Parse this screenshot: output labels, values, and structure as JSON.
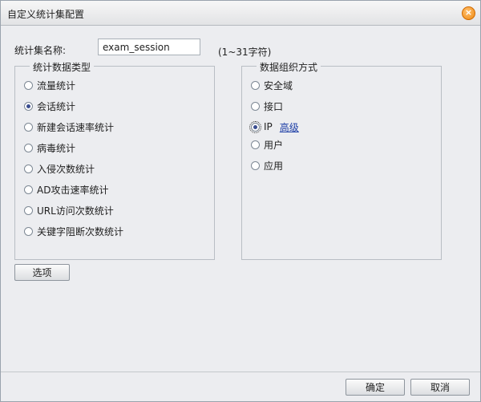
{
  "dialog": {
    "title": "自定义统计集配置",
    "close_icon": "close-icon"
  },
  "name_field": {
    "label": "统计集名称:",
    "value": "exam_session",
    "hint": "(1~31字符)"
  },
  "stats_type": {
    "legend": "统计数据类型",
    "options": [
      {
        "label": "流量统计",
        "checked": false
      },
      {
        "label": "会话统计",
        "checked": true
      },
      {
        "label": "新建会话速率统计",
        "checked": false
      },
      {
        "label": "病毒统计",
        "checked": false
      },
      {
        "label": "入侵次数统计",
        "checked": false
      },
      {
        "label": "AD攻击速率统计",
        "checked": false
      },
      {
        "label": "URL访问次数统计",
        "checked": false
      },
      {
        "label": "关键字阻断次数统计",
        "checked": false
      }
    ]
  },
  "org_method": {
    "legend": "数据组织方式",
    "options": [
      {
        "label": "安全域",
        "checked": false
      },
      {
        "label": "接口",
        "checked": false
      },
      {
        "label": "IP",
        "checked": true,
        "link": "高级"
      },
      {
        "label": "用户",
        "checked": false
      },
      {
        "label": "应用",
        "checked": false
      }
    ]
  },
  "buttons": {
    "options": "选项",
    "ok": "确定",
    "cancel": "取消"
  },
  "colors": {
    "background": "#ecedf0",
    "link": "#1d3ea6",
    "close_button": "#f08a10"
  }
}
